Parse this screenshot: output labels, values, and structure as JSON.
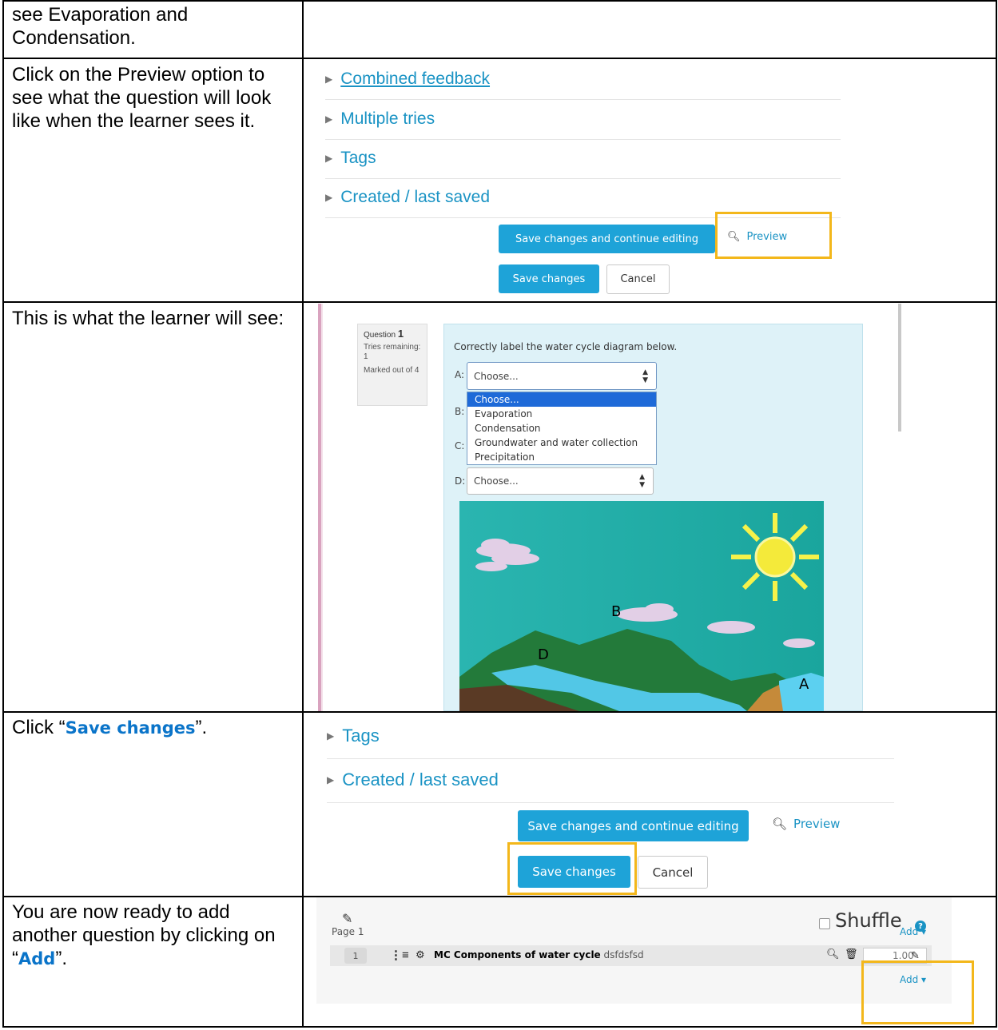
{
  "rows": [
    {
      "text": "see Evaporation and Condensation."
    },
    {
      "text": "Click on the Preview option to see what the question will look like when the learner sees it."
    },
    {
      "text": "This is what the learner will see:"
    },
    {
      "text_before": "Click “",
      "highlight": "Save changes",
      "text_after": "”."
    },
    {
      "text_before": "You are now ready to add another question by clicking on “",
      "highlight": "Add",
      "text_after": "”."
    }
  ],
  "settings_panel": {
    "sections": [
      "Combined feedback",
      "Multiple tries",
      "Tags",
      "Created / last saved"
    ],
    "save_continue_label": "Save changes and continue editing",
    "preview_label": "Preview",
    "save_label": "Save changes",
    "cancel_label": "Cancel"
  },
  "question_preview": {
    "question_word": "Question",
    "question_number": "1",
    "tries": "Tries remaining: 1",
    "marked": "Marked out of 4",
    "prompt": "Correctly label the water cycle diagram below.",
    "labels": [
      "A:",
      "B:",
      "C:",
      "D:"
    ],
    "select_a_value": "Choose...",
    "select_d_value": "Choose...",
    "dropdown_options": [
      "Choose...",
      "Evaporation",
      "Condensation",
      "Groundwater and water collection",
      "Precipitation"
    ],
    "diagram_labels": [
      "B",
      "D",
      "A"
    ]
  },
  "save_panel": {
    "sections": [
      "Tags",
      "Created / last saved"
    ],
    "save_continue_label": "Save changes and continue editing",
    "preview_label": "Preview",
    "save_label": "Save changes",
    "cancel_label": "Cancel"
  },
  "quiz_panel": {
    "shuffle_label": "Shuffle",
    "help_symbol": "?",
    "page_label": "Page 1",
    "add_label": "Add ▾",
    "slot_number": "1",
    "question_name": "MC Components of water cycle",
    "question_text": "dsfdsfsd",
    "mark_value": "1.00"
  },
  "colors": {
    "highlight_box": "#f3b71b",
    "primary_button": "#1ea3d8",
    "link": "#1a93c4",
    "emphasis_text": "#0a74c9"
  }
}
